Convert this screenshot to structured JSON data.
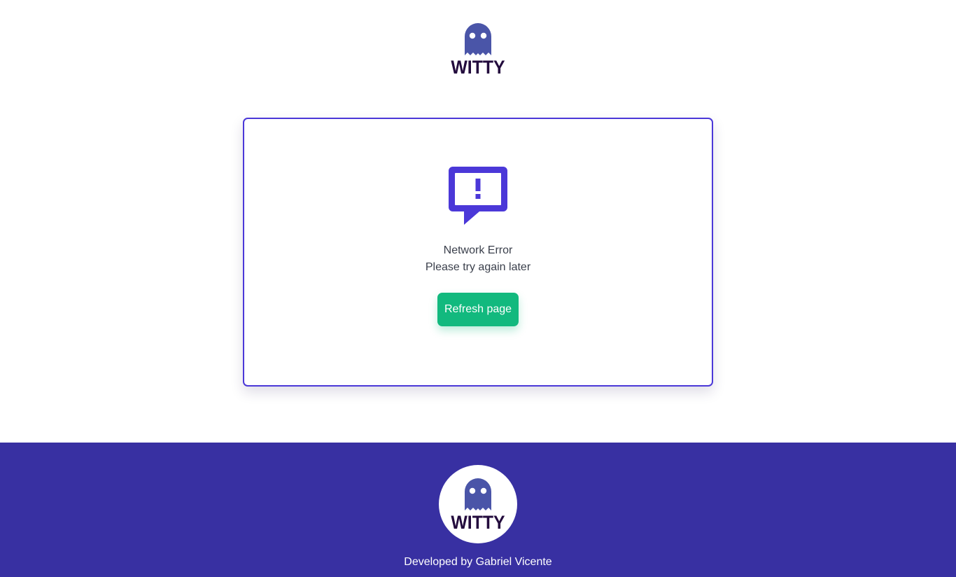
{
  "header": {
    "logo_icon": "ghost-icon",
    "logo_text": "WITTY"
  },
  "error_card": {
    "icon": "alert-message-icon",
    "title": "Network Error",
    "subtitle": "Please try again later",
    "refresh_label": "Refresh page"
  },
  "footer": {
    "logo_icon": "ghost-icon",
    "logo_text": "WITTY",
    "credit": "Developed by Gabriel Vicente"
  },
  "colors": {
    "accent": "#4b38d8",
    "footer_bg": "#3830a2",
    "button_bg": "#12b97e",
    "ghost": "#4a55a8",
    "logo_text": "#230b3d"
  }
}
